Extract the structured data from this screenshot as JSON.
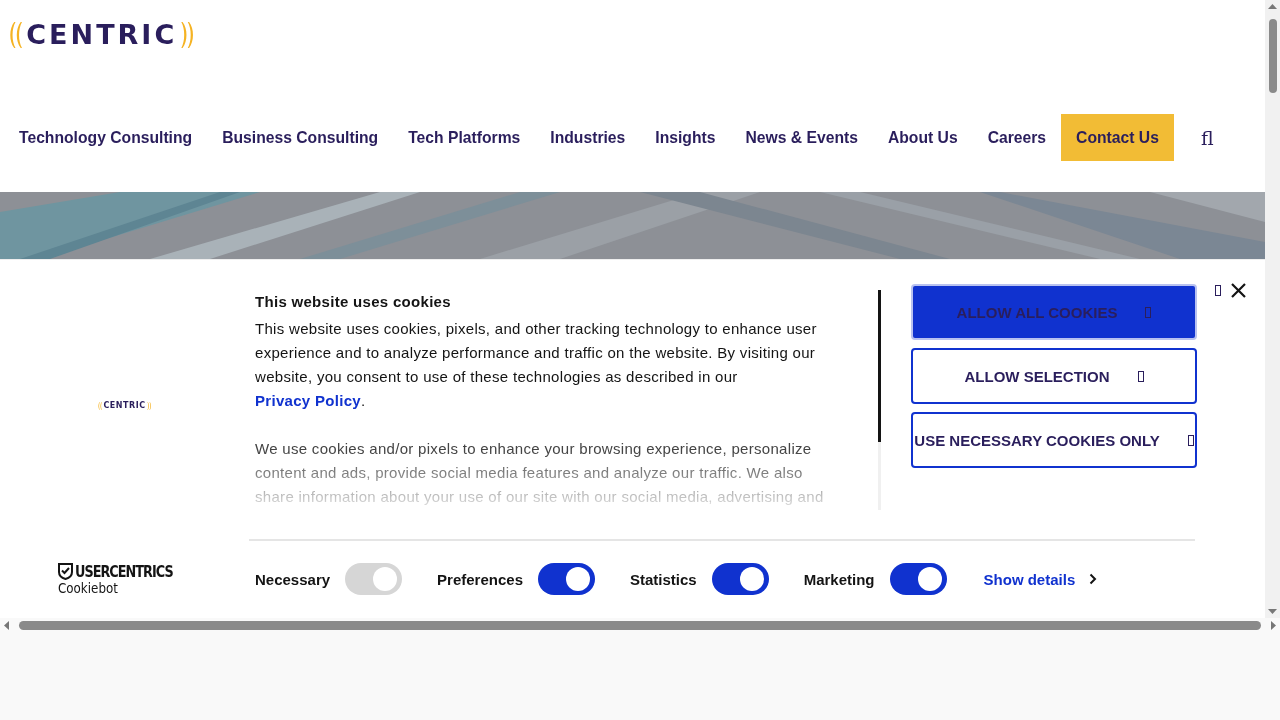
{
  "header": {
    "logo": "CENTRIC"
  },
  "nav": {
    "items": [
      {
        "label": "Technology Consulting",
        "kind": "link"
      },
      {
        "label": "Business Consulting",
        "kind": "link"
      },
      {
        "label": "Tech Platforms",
        "kind": "link"
      },
      {
        "label": "Industries",
        "kind": "link"
      },
      {
        "label": "Insights",
        "kind": "link"
      },
      {
        "label": "News & Events",
        "kind": "link"
      },
      {
        "label": "About Us",
        "kind": "link"
      },
      {
        "label": "Careers",
        "kind": "link"
      },
      {
        "label": "Contact Us",
        "kind": "cta"
      }
    ],
    "search": "fl"
  },
  "cookie_banner": {
    "logo": "CENTRIC",
    "brand": "USERCENTRICS",
    "product": "Cookiebot",
    "title": "This website uses cookies",
    "intro": "This website uses cookies, pixels, and other tracking technology to enhance user experience and to analyze performance and traffic on the website. By visiting our website, you consent to use of these technologies as described in our ",
    "privacy_link": "Privacy Policy",
    "intro_end": ".",
    "details": "We use cookies and/or pixels to enhance your browsing experience, personalize content and ads, provide social media features and analyze our traffic. We also share information about your use of our site with our social media, advertising and",
    "buttons": [
      {
        "label": "ALLOW ALL COOKIES",
        "kind": "primary"
      },
      {
        "label": "ALLOW SELECTION",
        "kind": "outline"
      },
      {
        "label": "USE NECESSARY COOKIES ONLY",
        "kind": "outline"
      }
    ],
    "toggles": [
      {
        "label": "Necessary",
        "on": true,
        "disabled": true
      },
      {
        "label": "Preferences",
        "on": true,
        "disabled": false
      },
      {
        "label": "Statistics",
        "on": true,
        "disabled": false
      },
      {
        "label": "Marketing",
        "on": true,
        "disabled": false
      }
    ],
    "show_details": "Show details"
  }
}
